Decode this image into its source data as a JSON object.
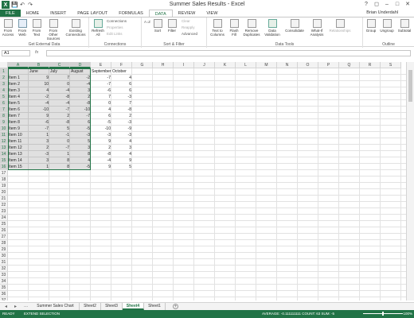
{
  "window": {
    "title": "Summer Sales Results - Excel"
  },
  "qat": {
    "save": "💾",
    "undo": "↶",
    "redo": "↷"
  },
  "window_controls": {
    "help": "?",
    "restore": "◻",
    "minimize": "–",
    "maximize": "□",
    "close": "✕"
  },
  "tabs": [
    "FILE",
    "HOME",
    "INSERT",
    "PAGE LAYOUT",
    "FORMULAS",
    "DATA",
    "REVIEW",
    "VIEW"
  ],
  "active_tab": "DATA",
  "user": "Brian Underdahl",
  "ribbon": {
    "groups": {
      "get_external": "Get External Data",
      "connections": "Connections",
      "sort_filter": "Sort & Filter",
      "data_tools": "Data Tools",
      "outline": "Outline"
    },
    "buttons": {
      "from_access": "From Access",
      "from_web": "From Web",
      "from_text": "From Text",
      "from_other": "From Other Sources",
      "existing": "Existing Connections",
      "refresh_all": "Refresh All",
      "sort_az": "A↓Z",
      "sort": "Sort",
      "filter": "Filter",
      "text_to_columns": "Text to Columns",
      "flash_fill": "Flash Fill",
      "remove_duplicates": "Remove Duplicates",
      "data_validation": "Data Validation",
      "consolidate": "Consolidate",
      "what_if": "What-If Analysis",
      "relationships": "Relationships",
      "group": "Group",
      "ungroup": "Ungroup",
      "subtotal": "Subtotal"
    },
    "small": {
      "connections": "Connections",
      "properties": "Properties",
      "edit_links": "Edit Links",
      "clear": "Clear",
      "reapply": "Reapply",
      "advanced": "Advanced"
    }
  },
  "namebox": "A1",
  "fx": "fx",
  "columns": [
    "A",
    "B",
    "C",
    "D",
    "E",
    "F",
    "G",
    "H",
    "I",
    "J",
    "K",
    "L",
    "M",
    "N",
    "O",
    "P",
    "Q",
    "R",
    "S"
  ],
  "row_count": 37,
  "table": {
    "headers": [
      "",
      "June",
      "July",
      "August",
      "September",
      "October"
    ],
    "rows": [
      [
        "Item 1",
        "9",
        "7",
        "-2",
        "-7",
        "4"
      ],
      [
        "Item 2",
        "10",
        "0",
        "-4",
        "-7",
        "6"
      ],
      [
        "Item 3",
        "4",
        "-4",
        "3",
        "-6",
        "6"
      ],
      [
        "Item 4",
        "-2",
        "-8",
        "2",
        "7",
        "-3"
      ],
      [
        "Item 5",
        "-4",
        "-4",
        "-8",
        "0",
        "7"
      ],
      [
        "Item 6",
        "-10",
        "-7",
        "-10",
        "4",
        "-8"
      ],
      [
        "Item 7",
        "9",
        "2",
        "-7",
        "6",
        "2"
      ],
      [
        "Item 8",
        "-6",
        "-8",
        "6",
        "-5",
        "-3"
      ],
      [
        "Item 9",
        "-7",
        "5",
        "-5",
        "-10",
        "-9"
      ],
      [
        "Item 10",
        "1",
        "-1",
        "-3",
        "-3",
        "-3"
      ],
      [
        "Item 11",
        "3",
        "0",
        "5",
        "9",
        "4"
      ],
      [
        "Item 12",
        "2",
        "-7",
        "3",
        "2",
        "3"
      ],
      [
        "Item 13",
        "-3",
        "1",
        "8",
        "-8",
        "4"
      ],
      [
        "Item 14",
        "3",
        "8",
        "4",
        "-4",
        "9"
      ],
      [
        "Item 15",
        "1",
        "8",
        "-5",
        "9",
        "5"
      ]
    ]
  },
  "sheets": [
    "Summer Sales Chart",
    "Sheet2",
    "Sheet3",
    "Sheet4",
    "Sheet1"
  ],
  "active_sheet": "Sheet4",
  "add_sheet": "+",
  "nav_arrows": {
    "prev": "◂",
    "next": "▸",
    "more": "..."
  },
  "status": {
    "ready": "READY",
    "mode": "EXTEND SELECTION",
    "summary": "AVERAGE: -0.111111111   COUNT: 63   SUM: -5",
    "zoom": "100%"
  }
}
